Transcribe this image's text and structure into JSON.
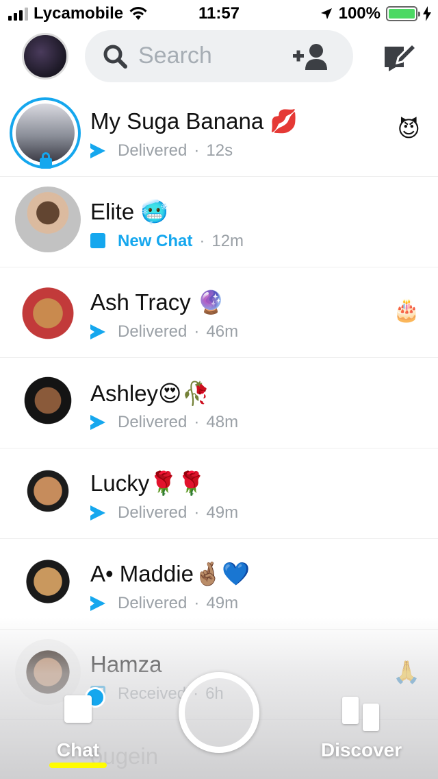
{
  "status_bar": {
    "carrier": "Lycamobile",
    "time": "11:57",
    "battery": "100%"
  },
  "header": {
    "search_placeholder": "Search"
  },
  "chats": [
    {
      "name": "My Suga Banana 💋",
      "status": "Delivered",
      "time": "12s",
      "status_type": "delivered",
      "right_emoji": "😈",
      "has_story": true
    },
    {
      "name": "Elite 🥶",
      "status": "New Chat",
      "time": "12m",
      "status_type": "new_chat",
      "right_emoji": ""
    },
    {
      "name": "Ash Tracy 🔮",
      "status": "Delivered",
      "time": "46m",
      "status_type": "delivered",
      "right_emoji": "🎂"
    },
    {
      "name": "Ashley😍🥀",
      "status": "Delivered",
      "time": "48m",
      "status_type": "delivered",
      "right_emoji": ""
    },
    {
      "name": "Lucky🌹🌹",
      "status": "Delivered",
      "time": "49m",
      "status_type": "delivered",
      "right_emoji": ""
    },
    {
      "name": "A• Maddie🤞🏽💙",
      "status": "Delivered",
      "time": "49m",
      "status_type": "delivered",
      "right_emoji": ""
    },
    {
      "name": "Hamza",
      "status": "Received",
      "time": "6h",
      "status_type": "received",
      "right_emoji": "🙏"
    }
  ],
  "partial_chat_name": "ougein",
  "nav": {
    "chat_label": "Chat",
    "discover_label": "Discover"
  },
  "colors": {
    "accent_blue": "#15a7ee",
    "snap_yellow": "#fffc00",
    "search_bg": "#eef0f2"
  }
}
